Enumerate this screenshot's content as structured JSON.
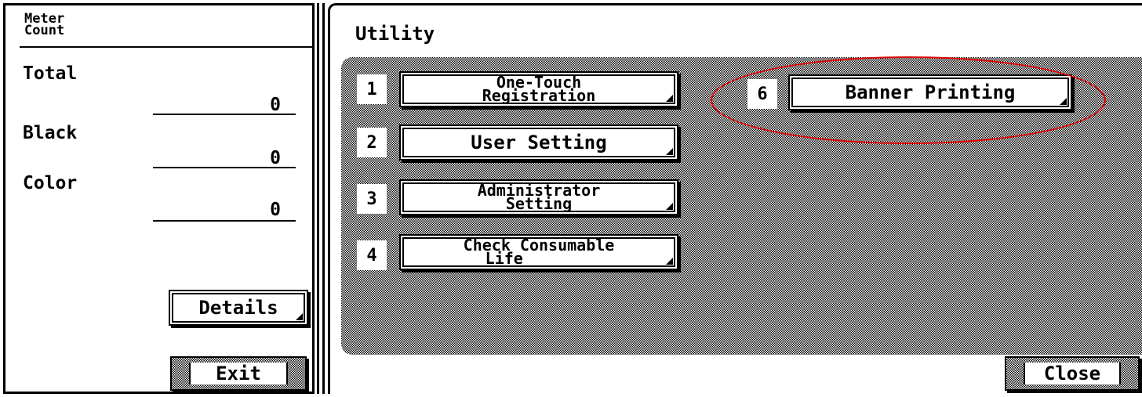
{
  "meter_count": {
    "title_line1": "Meter",
    "title_line2": "Count",
    "rows": [
      {
        "label": "Total",
        "value": "0"
      },
      {
        "label": "Black",
        "value": "0"
      },
      {
        "label": "Color",
        "value": "0"
      }
    ],
    "details_label": "Details",
    "exit_label": "Exit"
  },
  "utility": {
    "title": "Utility",
    "items": [
      {
        "number": "1",
        "line1": "One-Touch",
        "line2": "Registration"
      },
      {
        "number": "2",
        "line1": "User Setting",
        "line2": ""
      },
      {
        "number": "3",
        "line1": "Administrator",
        "line2": "Setting"
      },
      {
        "number": "4",
        "line1": "Check Consumable",
        "line2": "Life"
      },
      {
        "number": "6",
        "line1": "Banner Printing",
        "line2": ""
      }
    ],
    "close_label": "Close"
  },
  "colors": {
    "highlight_ellipse": "#e00000"
  }
}
